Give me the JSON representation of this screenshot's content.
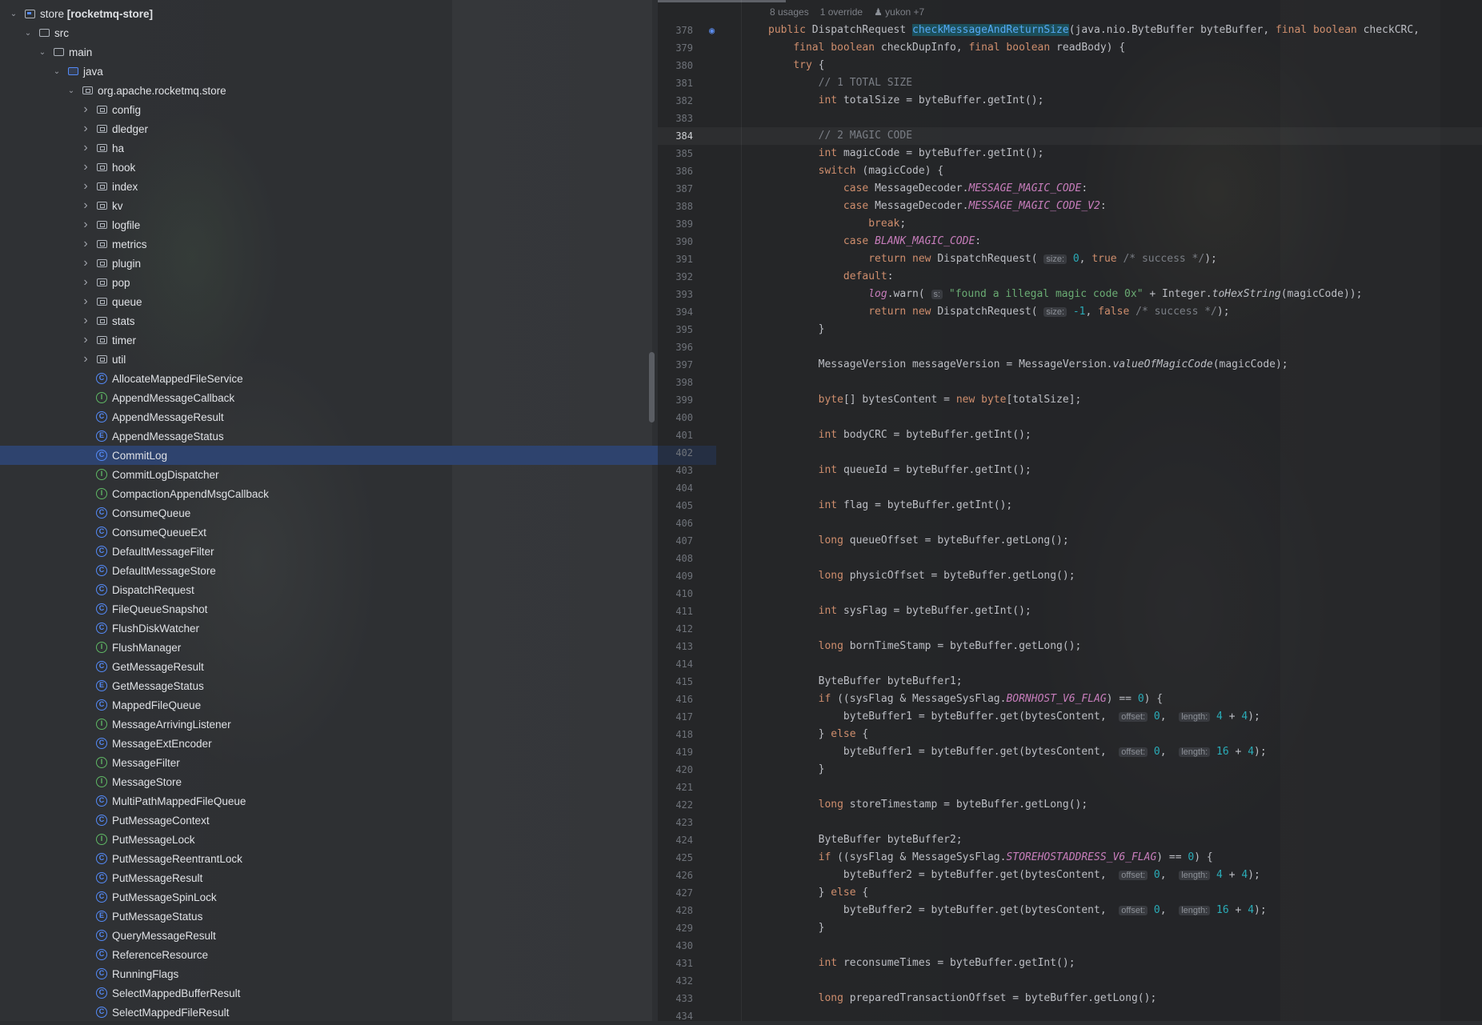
{
  "project": {
    "root": {
      "name": "store",
      "module": "[rocketmq-store]"
    },
    "src": "src",
    "main": "main",
    "java": "java",
    "package": "org.apache.rocketmq.store",
    "folders": [
      "config",
      "dledger",
      "ha",
      "hook",
      "index",
      "kv",
      "logfile",
      "metrics",
      "plugin",
      "pop",
      "queue",
      "stats",
      "timer",
      "util"
    ],
    "classes": [
      {
        "name": "AllocateMappedFileService",
        "kind": "class"
      },
      {
        "name": "AppendMessageCallback",
        "kind": "interface"
      },
      {
        "name": "AppendMessageResult",
        "kind": "class"
      },
      {
        "name": "AppendMessageStatus",
        "kind": "enum"
      },
      {
        "name": "CommitLog",
        "kind": "class",
        "selected": true
      },
      {
        "name": "CommitLogDispatcher",
        "kind": "interface"
      },
      {
        "name": "CompactionAppendMsgCallback",
        "kind": "interface"
      },
      {
        "name": "ConsumeQueue",
        "kind": "class"
      },
      {
        "name": "ConsumeQueueExt",
        "kind": "class"
      },
      {
        "name": "DefaultMessageFilter",
        "kind": "class"
      },
      {
        "name": "DefaultMessageStore",
        "kind": "class"
      },
      {
        "name": "DispatchRequest",
        "kind": "class"
      },
      {
        "name": "FileQueueSnapshot",
        "kind": "class"
      },
      {
        "name": "FlushDiskWatcher",
        "kind": "class"
      },
      {
        "name": "FlushManager",
        "kind": "interface"
      },
      {
        "name": "GetMessageResult",
        "kind": "class"
      },
      {
        "name": "GetMessageStatus",
        "kind": "enum"
      },
      {
        "name": "MappedFileQueue",
        "kind": "class"
      },
      {
        "name": "MessageArrivingListener",
        "kind": "interface"
      },
      {
        "name": "MessageExtEncoder",
        "kind": "class"
      },
      {
        "name": "MessageFilter",
        "kind": "interface"
      },
      {
        "name": "MessageStore",
        "kind": "interface"
      },
      {
        "name": "MultiPathMappedFileQueue",
        "kind": "class"
      },
      {
        "name": "PutMessageContext",
        "kind": "class"
      },
      {
        "name": "PutMessageLock",
        "kind": "interface"
      },
      {
        "name": "PutMessageReentrantLock",
        "kind": "class"
      },
      {
        "name": "PutMessageResult",
        "kind": "class"
      },
      {
        "name": "PutMessageSpinLock",
        "kind": "class"
      },
      {
        "name": "PutMessageStatus",
        "kind": "enum"
      },
      {
        "name": "QueryMessageResult",
        "kind": "class"
      },
      {
        "name": "ReferenceResource",
        "kind": "class"
      },
      {
        "name": "RunningFlags",
        "kind": "class"
      },
      {
        "name": "SelectMappedBufferResult",
        "kind": "class"
      },
      {
        "name": "SelectMappedFileResult",
        "kind": "class"
      }
    ]
  },
  "editor": {
    "meta": {
      "usages": "8 usages",
      "override": "1 override",
      "author": "yukon +7"
    },
    "current_line": 384,
    "lines": [
      {
        "n": 378,
        "parts": [
          [
            "kw",
            "public "
          ],
          [
            "",
            "DispatchRequest "
          ],
          [
            "fn-hl",
            "checkMessageAndReturnSize"
          ],
          [
            "",
            "(java.nio.ByteBuffer byteBuffer, "
          ],
          [
            "kw",
            "final boolean "
          ],
          [
            "",
            "checkCRC,"
          ]
        ],
        "icon": true
      },
      {
        "n": 379,
        "parts": [
          [
            "",
            "    "
          ],
          [
            "kw",
            "final boolean "
          ],
          [
            "",
            "checkDupInfo, "
          ],
          [
            "kw",
            "final boolean "
          ],
          [
            "",
            "readBody) {"
          ]
        ]
      },
      {
        "n": 380,
        "parts": [
          [
            "",
            "    "
          ],
          [
            "kw",
            "try "
          ],
          [
            "",
            "{"
          ]
        ]
      },
      {
        "n": 381,
        "parts": [
          [
            "",
            "        "
          ],
          [
            "cmt",
            "// 1 TOTAL SIZE"
          ]
        ]
      },
      {
        "n": 382,
        "parts": [
          [
            "",
            "        "
          ],
          [
            "kw",
            "int "
          ],
          [
            "",
            "totalSize = byteBuffer.getInt();"
          ]
        ]
      },
      {
        "n": 383,
        "parts": []
      },
      {
        "n": 384,
        "parts": [
          [
            "",
            "        "
          ],
          [
            "cmt",
            "// 2 MAGIC CODE"
          ]
        ]
      },
      {
        "n": 385,
        "parts": [
          [
            "",
            "        "
          ],
          [
            "kw",
            "int "
          ],
          [
            "",
            "magicCode = byteBuffer.getInt();"
          ]
        ]
      },
      {
        "n": 386,
        "parts": [
          [
            "",
            "        "
          ],
          [
            "kw",
            "switch "
          ],
          [
            "",
            "(magicCode) {"
          ]
        ]
      },
      {
        "n": 387,
        "parts": [
          [
            "",
            "            "
          ],
          [
            "kw",
            "case "
          ],
          [
            "",
            "MessageDecoder."
          ],
          [
            "fld",
            "MESSAGE_MAGIC_CODE"
          ],
          [
            "",
            ":"
          ]
        ]
      },
      {
        "n": 388,
        "parts": [
          [
            "",
            "            "
          ],
          [
            "kw",
            "case "
          ],
          [
            "",
            "MessageDecoder."
          ],
          [
            "fld",
            "MESSAGE_MAGIC_CODE_V2"
          ],
          [
            "",
            ":"
          ]
        ]
      },
      {
        "n": 389,
        "parts": [
          [
            "",
            "                "
          ],
          [
            "kw",
            "break"
          ],
          [
            "",
            ";"
          ]
        ]
      },
      {
        "n": 390,
        "parts": [
          [
            "",
            "            "
          ],
          [
            "kw",
            "case "
          ],
          [
            "fld",
            "BLANK_MAGIC_CODE"
          ],
          [
            "",
            ":"
          ]
        ]
      },
      {
        "n": 391,
        "parts": [
          [
            "",
            "                "
          ],
          [
            "kw",
            "return new "
          ],
          [
            "",
            "DispatchRequest( "
          ],
          [
            "hint",
            "size:"
          ],
          [
            "num",
            " 0"
          ],
          [
            "",
            ", "
          ],
          [
            "kw",
            "true "
          ],
          [
            "cmt",
            "/* success */"
          ],
          [
            "",
            ");"
          ]
        ]
      },
      {
        "n": 392,
        "parts": [
          [
            "",
            "            "
          ],
          [
            "kw",
            "default"
          ],
          [
            "",
            ":"
          ]
        ]
      },
      {
        "n": 393,
        "parts": [
          [
            "",
            "                "
          ],
          [
            "fld",
            "log"
          ],
          [
            "",
            ".warn( "
          ],
          [
            "hint",
            "s:"
          ],
          [
            "str",
            " \"found a illegal magic code 0x\""
          ],
          [
            "",
            " + Integer."
          ],
          [
            "itl",
            "toHexString"
          ],
          [
            "",
            "(magicCode));"
          ]
        ]
      },
      {
        "n": 394,
        "parts": [
          [
            "",
            "                "
          ],
          [
            "kw",
            "return new "
          ],
          [
            "",
            "DispatchRequest( "
          ],
          [
            "hint",
            "size:"
          ],
          [
            "num",
            " -1"
          ],
          [
            "",
            ", "
          ],
          [
            "kw",
            "false "
          ],
          [
            "cmt",
            "/* success */"
          ],
          [
            "",
            ");"
          ]
        ]
      },
      {
        "n": 395,
        "parts": [
          [
            "",
            "        }"
          ]
        ]
      },
      {
        "n": 396,
        "parts": []
      },
      {
        "n": 397,
        "parts": [
          [
            "",
            "        MessageVersion messageVersion = MessageVersion."
          ],
          [
            "itl",
            "valueOfMagicCode"
          ],
          [
            "",
            "(magicCode);"
          ]
        ]
      },
      {
        "n": 398,
        "parts": []
      },
      {
        "n": 399,
        "parts": [
          [
            "",
            "        "
          ],
          [
            "kw",
            "byte"
          ],
          [
            "",
            "[] bytesContent = "
          ],
          [
            "kw",
            "new byte"
          ],
          [
            "",
            "[totalSize];"
          ]
        ]
      },
      {
        "n": 400,
        "parts": []
      },
      {
        "n": 401,
        "parts": [
          [
            "",
            "        "
          ],
          [
            "kw",
            "int "
          ],
          [
            "",
            "bodyCRC = byteBuffer.getInt();"
          ]
        ]
      },
      {
        "n": 402,
        "parts": []
      },
      {
        "n": 403,
        "parts": [
          [
            "",
            "        "
          ],
          [
            "kw",
            "int "
          ],
          [
            "",
            "queueId = byteBuffer.getInt();"
          ]
        ]
      },
      {
        "n": 404,
        "parts": []
      },
      {
        "n": 405,
        "parts": [
          [
            "",
            "        "
          ],
          [
            "kw",
            "int "
          ],
          [
            "",
            "flag = byteBuffer.getInt();"
          ]
        ]
      },
      {
        "n": 406,
        "parts": []
      },
      {
        "n": 407,
        "parts": [
          [
            "",
            "        "
          ],
          [
            "kw",
            "long "
          ],
          [
            "",
            "queueOffset = byteBuffer.getLong();"
          ]
        ]
      },
      {
        "n": 408,
        "parts": []
      },
      {
        "n": 409,
        "parts": [
          [
            "",
            "        "
          ],
          [
            "kw",
            "long "
          ],
          [
            "",
            "physicOffset = byteBuffer.getLong();"
          ]
        ]
      },
      {
        "n": 410,
        "parts": []
      },
      {
        "n": 411,
        "parts": [
          [
            "",
            "        "
          ],
          [
            "kw",
            "int "
          ],
          [
            "",
            "sysFlag = byteBuffer.getInt();"
          ]
        ]
      },
      {
        "n": 412,
        "parts": []
      },
      {
        "n": 413,
        "parts": [
          [
            "",
            "        "
          ],
          [
            "kw",
            "long "
          ],
          [
            "",
            "bornTimeStamp = byteBuffer.getLong();"
          ]
        ]
      },
      {
        "n": 414,
        "parts": []
      },
      {
        "n": 415,
        "parts": [
          [
            "",
            "        ByteBuffer byteBuffer1;"
          ]
        ]
      },
      {
        "n": 416,
        "parts": [
          [
            "",
            "        "
          ],
          [
            "kw",
            "if "
          ],
          [
            "",
            "((sysFlag & MessageSysFlag."
          ],
          [
            "fld",
            "BORNHOST_V6_FLAG"
          ],
          [
            "",
            ") == "
          ],
          [
            "num",
            "0"
          ],
          [
            "",
            ") {"
          ]
        ]
      },
      {
        "n": 417,
        "parts": [
          [
            "",
            "            byteBuffer1 = byteBuffer.get(bytesContent,  "
          ],
          [
            "hint",
            "offset:"
          ],
          [
            "num",
            " 0"
          ],
          [
            "",
            ",  "
          ],
          [
            "hint",
            "length:"
          ],
          [
            "num",
            " 4"
          ],
          [
            "",
            " + "
          ],
          [
            "num",
            "4"
          ],
          [
            "",
            ");"
          ]
        ]
      },
      {
        "n": 418,
        "parts": [
          [
            "",
            "        } "
          ],
          [
            "kw",
            "else "
          ],
          [
            "",
            "{"
          ]
        ]
      },
      {
        "n": 419,
        "parts": [
          [
            "",
            "            byteBuffer1 = byteBuffer.get(bytesContent,  "
          ],
          [
            "hint",
            "offset:"
          ],
          [
            "num",
            " 0"
          ],
          [
            "",
            ",  "
          ],
          [
            "hint",
            "length:"
          ],
          [
            "num",
            " 16"
          ],
          [
            "",
            " + "
          ],
          [
            "num",
            "4"
          ],
          [
            "",
            ");"
          ]
        ]
      },
      {
        "n": 420,
        "parts": [
          [
            "",
            "        }"
          ]
        ]
      },
      {
        "n": 421,
        "parts": []
      },
      {
        "n": 422,
        "parts": [
          [
            "",
            "        "
          ],
          [
            "kw",
            "long "
          ],
          [
            "",
            "storeTimestamp = byteBuffer.getLong();"
          ]
        ]
      },
      {
        "n": 423,
        "parts": []
      },
      {
        "n": 424,
        "parts": [
          [
            "",
            "        ByteBuffer byteBuffer2;"
          ]
        ]
      },
      {
        "n": 425,
        "parts": [
          [
            "",
            "        "
          ],
          [
            "kw",
            "if "
          ],
          [
            "",
            "((sysFlag & MessageSysFlag."
          ],
          [
            "fld",
            "STOREHOSTADDRESS_V6_FLAG"
          ],
          [
            "",
            ") == "
          ],
          [
            "num",
            "0"
          ],
          [
            "",
            ") {"
          ]
        ]
      },
      {
        "n": 426,
        "parts": [
          [
            "",
            "            byteBuffer2 = byteBuffer.get(bytesContent,  "
          ],
          [
            "hint",
            "offset:"
          ],
          [
            "num",
            " 0"
          ],
          [
            "",
            ",  "
          ],
          [
            "hint",
            "length:"
          ],
          [
            "num",
            " 4"
          ],
          [
            "",
            " + "
          ],
          [
            "num",
            "4"
          ],
          [
            "",
            ");"
          ]
        ]
      },
      {
        "n": 427,
        "parts": [
          [
            "",
            "        } "
          ],
          [
            "kw",
            "else "
          ],
          [
            "",
            "{"
          ]
        ]
      },
      {
        "n": 428,
        "parts": [
          [
            "",
            "            byteBuffer2 = byteBuffer.get(bytesContent,  "
          ],
          [
            "hint",
            "offset:"
          ],
          [
            "num",
            " 0"
          ],
          [
            "",
            ",  "
          ],
          [
            "hint",
            "length:"
          ],
          [
            "num",
            " 16"
          ],
          [
            "",
            " + "
          ],
          [
            "num",
            "4"
          ],
          [
            "",
            ");"
          ]
        ]
      },
      {
        "n": 429,
        "parts": [
          [
            "",
            "        }"
          ]
        ]
      },
      {
        "n": 430,
        "parts": []
      },
      {
        "n": 431,
        "parts": [
          [
            "",
            "        "
          ],
          [
            "kw",
            "int "
          ],
          [
            "",
            "reconsumeTimes = byteBuffer.getInt();"
          ]
        ]
      },
      {
        "n": 432,
        "parts": []
      },
      {
        "n": 433,
        "parts": [
          [
            "",
            "        "
          ],
          [
            "kw",
            "long "
          ],
          [
            "",
            "preparedTransactionOffset = byteBuffer.getLong();"
          ]
        ]
      },
      {
        "n": 434,
        "parts": []
      }
    ]
  }
}
